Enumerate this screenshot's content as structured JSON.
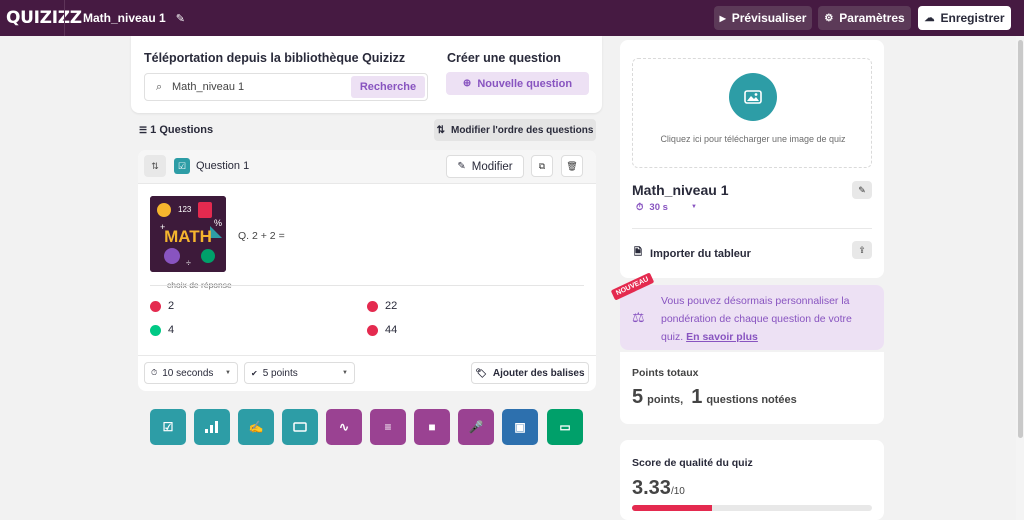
{
  "topbar": {
    "logo": "QUIZIZZ",
    "quiz_name": "Math_niveau 1",
    "preview_label": "Prévisualiser",
    "settings_label": "Paramètres",
    "save_label": "Enregistrer",
    "bg_color": "#461a42"
  },
  "library": {
    "title": "Téléportation depuis la bibliothèque Quizizz",
    "search_value": "Math_niveau 1",
    "search_button": "Recherche"
  },
  "create": {
    "title": "Créer une question",
    "new_question_label": "Nouvelle question"
  },
  "questions_bar": {
    "count_label": "1 Questions",
    "reorder_label": "Modifier l'ordre des questions"
  },
  "question": {
    "label": "Question 1",
    "edit_label": "Modifier",
    "text": "Q. 2 + 2 =",
    "choices_label": "choix de réponse",
    "image_text": "MATH",
    "answers": [
      {
        "text": "2",
        "correct": false
      },
      {
        "text": "22",
        "correct": false
      },
      {
        "text": "4",
        "correct": true
      },
      {
        "text": "44",
        "correct": false
      }
    ],
    "time_select": "10 seconds",
    "points_select": "5 points",
    "tags_label": "Ajouter des balises"
  },
  "question_types": [
    {
      "icon": "multiple-choice-icon",
      "color": "#2d9da6"
    },
    {
      "icon": "poll-icon",
      "color": "#2d9da6"
    },
    {
      "icon": "fill-blank-icon",
      "color": "#2d9da6"
    },
    {
      "icon": "open-field-icon",
      "color": "#2d9da6"
    },
    {
      "icon": "draw-icon",
      "color": "#9a4292"
    },
    {
      "icon": "open-ended-icon",
      "color": "#9a4292"
    },
    {
      "icon": "video-icon",
      "color": "#9a4292"
    },
    {
      "icon": "audio-icon",
      "color": "#9a4292"
    },
    {
      "icon": "slide-icon",
      "color": "#2d70ae"
    },
    {
      "icon": "presentation-icon",
      "color": "#00a06a"
    }
  ],
  "sidebar": {
    "upload_text": "Cliquez ici pour télécharger une image de quiz",
    "quiz_title": "Math_niveau 1",
    "timer": "30 s",
    "import_label": "Importer du tableur",
    "promo_badge": "NOUVEAU",
    "promo_text": "Vous pouvez désormais personnaliser la pondération de chaque question de votre quiz.",
    "promo_link": "En savoir plus",
    "points_label": "Points totaux",
    "points_value": "5",
    "points_unit": "points,",
    "graded_value": "1",
    "graded_unit": "questions notées",
    "quality_label": "Score de qualité du quiz",
    "quality_value": "3.33",
    "quality_max": "/10",
    "quality_fraction": 0.333
  }
}
